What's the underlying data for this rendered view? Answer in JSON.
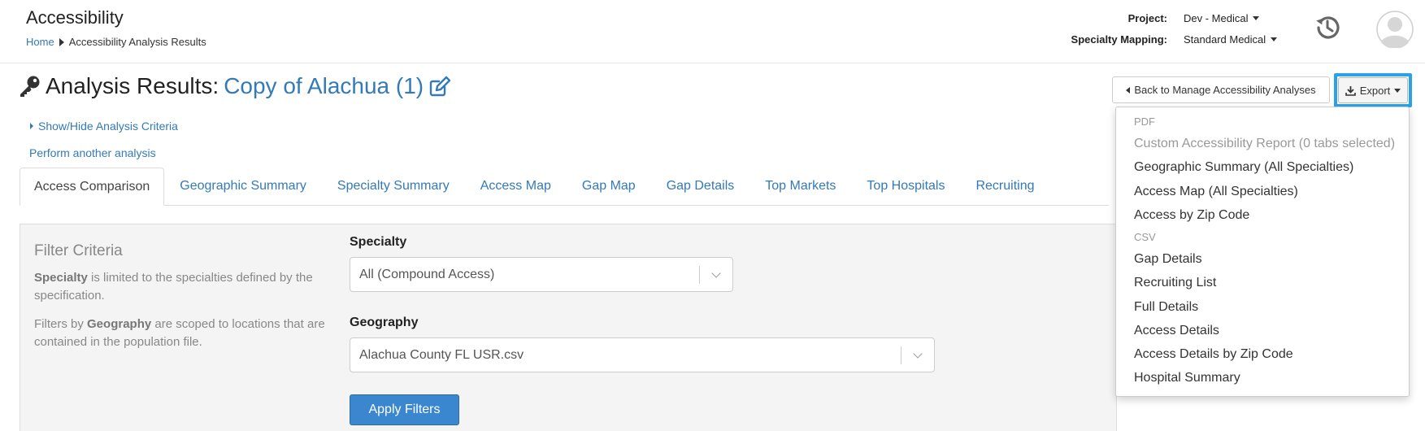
{
  "header": {
    "app_title": "Accessibility",
    "breadcrumb": {
      "home": "Home",
      "current": "Accessibility Analysis Results"
    },
    "project_label": "Project:",
    "project_value": "Dev - Medical",
    "specialty_mapping_label": "Specialty Mapping:",
    "specialty_mapping_value": "Standard Medical"
  },
  "title_row": {
    "prefix": "Analysis Results:",
    "analysis_name": "Copy of Alachua (1)",
    "back_button": "Back to Manage Accessibility Analyses",
    "export_button": "Export"
  },
  "links": {
    "toggle_criteria": "Show/Hide Analysis Criteria",
    "perform_another": "Perform another analysis"
  },
  "tabs": [
    {
      "label": "Access Comparison",
      "active": true
    },
    {
      "label": "Geographic Summary",
      "active": false
    },
    {
      "label": "Specialty Summary",
      "active": false
    },
    {
      "label": "Access Map",
      "active": false
    },
    {
      "label": "Gap Map",
      "active": false
    },
    {
      "label": "Gap Details",
      "active": false
    },
    {
      "label": "Top Markets",
      "active": false
    },
    {
      "label": "Top Hospitals",
      "active": false
    },
    {
      "label": "Recruiting",
      "active": false
    }
  ],
  "filter": {
    "title": "Filter Criteria",
    "specialty_note_bold": "Specialty",
    "specialty_note_rest": " is limited to the specialties defined by the specification.",
    "geo_note_start": "Filters by ",
    "geo_note_bold": "Geography",
    "geo_note_rest": " are scoped to locations that are contained in the population file.",
    "specialty_label": "Specialty",
    "specialty_value": "All (Compound Access)",
    "geography_label": "Geography",
    "geography_value": "Alachua County FL USR.csv",
    "apply_button": "Apply Filters"
  },
  "export_menu": {
    "pdf_header": "PDF",
    "custom_report": "Custom Accessibility Report (0 tabs selected)",
    "pdf_items": [
      "Geographic Summary (All Specialties)",
      "Access Map (All Specialties)",
      "Access by Zip Code"
    ],
    "csv_header": "CSV",
    "csv_items": [
      "Gap Details",
      "Recruiting List",
      "Full Details",
      "Access Details",
      "Access Details by Zip Code",
      "Hospital Summary"
    ]
  },
  "colors": {
    "link": "#337ab7",
    "focus_ring": "#29a3e8",
    "primary_button": "#3a87d0"
  }
}
